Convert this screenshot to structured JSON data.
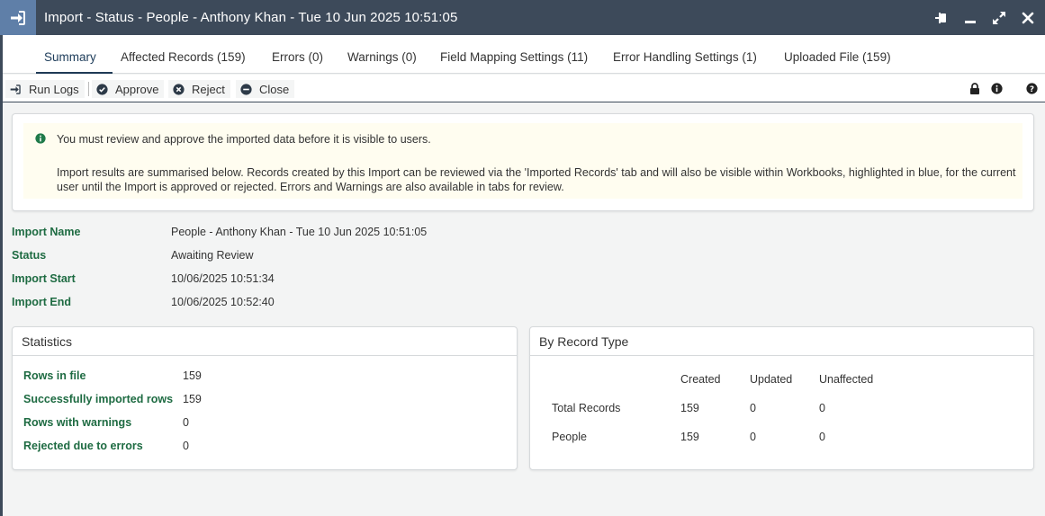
{
  "window": {
    "title": "Import - Status - People - Anthony Khan - Tue 10 Jun 2025 10:51:05",
    "icon": "sign-in-icon",
    "controls": [
      "pin-icon",
      "minimize-icon",
      "maximize-icon",
      "close-icon"
    ]
  },
  "tabs": [
    {
      "label": "Summary",
      "active": true
    },
    {
      "label": "Affected Records (159)"
    },
    {
      "label": "Errors (0)"
    },
    {
      "label": "Warnings (0)"
    },
    {
      "label": "Field Mapping Settings (11)"
    },
    {
      "label": "Error Handling Settings (1)"
    },
    {
      "label": "Uploaded File (159)"
    }
  ],
  "toolbar": {
    "run_logs": "Run Logs",
    "approve": "Approve",
    "reject": "Reject",
    "close": "Close",
    "right_icons": [
      "lock-icon",
      "info-icon",
      "help-icon"
    ]
  },
  "notice": {
    "line1": "You must review and approve the imported data before it is visible to users.",
    "line2": "Import results are summarised below. Records created by this Import can be reviewed via the 'Imported Records' tab and will also be visible within Workbooks, highlighted in blue, for the current user until the Import is approved or rejected. Errors and Warnings are also available in tabs for review."
  },
  "details": [
    {
      "label": "Import Name",
      "value": "People - Anthony Khan - Tue 10 Jun 2025 10:51:05"
    },
    {
      "label": "Status",
      "value": "Awaiting Review"
    },
    {
      "label": "Import Start",
      "value": "10/06/2025 10:51:34"
    },
    {
      "label": "Import End",
      "value": "10/06/2025 10:52:40"
    }
  ],
  "statistics": {
    "title": "Statistics",
    "rows": [
      {
        "label": "Rows in file",
        "value": "159"
      },
      {
        "label": "Successfully imported rows",
        "value": "159"
      },
      {
        "label": "Rows with warnings",
        "value": "0"
      },
      {
        "label": "Rejected due to errors",
        "value": "0"
      }
    ]
  },
  "by_record_type": {
    "title": "By Record Type",
    "columns": [
      "Created",
      "Updated",
      "Unaffected"
    ],
    "rows": [
      {
        "label": "Total Records",
        "values": [
          "159",
          "0",
          "0"
        ]
      },
      {
        "label": "People",
        "values": [
          "159",
          "0",
          "0"
        ]
      }
    ]
  },
  "colors": {
    "titlebar": "#3d4a5a",
    "title_icon_bg": "#5f7fa8",
    "label_green": "#1e6b42",
    "notice_bg": "#fffdf0",
    "info_icon_green": "#1f7a4a"
  }
}
